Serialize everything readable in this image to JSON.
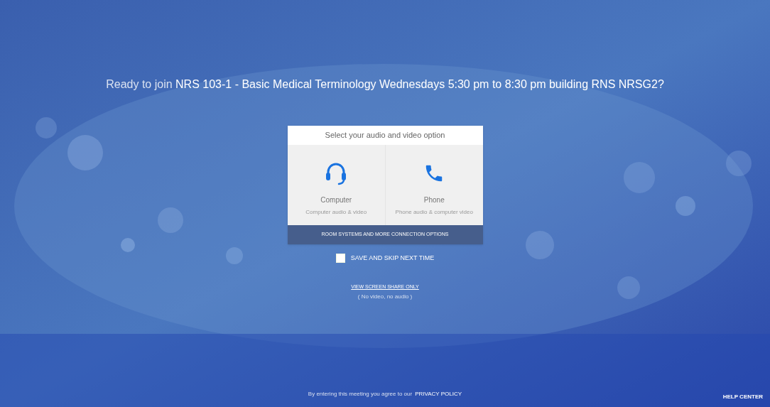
{
  "heading": "Ready to join **NRS 103-1 - Basic Medical Terminology Wednesdays 5:30 pm to 8:30 pm building RNS NRSG2?**",
  "dialog": {
    "title": "Select your audio and video option",
    "options": [
      {
        "kind": "computer",
        "label": "Computer",
        "sublabel": "Computer audio & video"
      },
      {
        "kind": "phone",
        "label": "Phone",
        "sublabel": "Phone audio & computer video"
      }
    ],
    "more_button": "ROOM SYSTEMS AND MORE CONNECTION OPTIONS"
  },
  "save_skip": {
    "label": "SAVE AND SKIP NEXT TIME",
    "checked": false
  },
  "screen_share": {
    "link": "VIEW SCREEN SHARE ONLY",
    "note": "( No video, no audio )"
  },
  "footer": {
    "agreement": "By entering this meeting you agree to our",
    "privacy_link": "PRIVACY POLICY",
    "help": "HELP CENTER"
  }
}
